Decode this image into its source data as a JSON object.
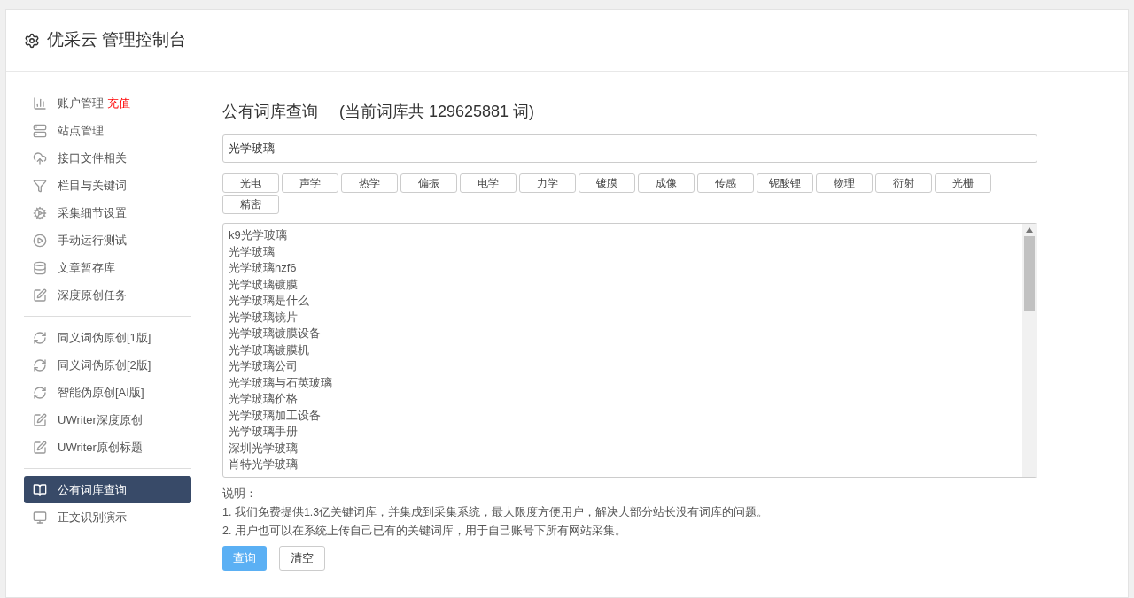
{
  "header": {
    "title": "优采云 管理控制台"
  },
  "sidebar": {
    "groups": [
      {
        "items": [
          {
            "label": "账户管理",
            "badge": "充值",
            "selected": false
          },
          {
            "label": "站点管理",
            "selected": false
          },
          {
            "label": "接口文件相关",
            "selected": false
          },
          {
            "label": "栏目与关键词",
            "selected": false
          },
          {
            "label": "采集细节设置",
            "selected": false
          },
          {
            "label": "手动运行测试",
            "selected": false
          },
          {
            "label": "文章暂存库",
            "selected": false
          },
          {
            "label": "深度原创任务",
            "selected": false
          }
        ]
      },
      {
        "items": [
          {
            "label": "同义词伪原创[1版]",
            "selected": false
          },
          {
            "label": "同义词伪原创[2版]",
            "selected": false
          },
          {
            "label": "智能伪原创[AI版]",
            "selected": false
          },
          {
            "label": "UWriter深度原创",
            "selected": false
          },
          {
            "label": "UWriter原创标题",
            "selected": false
          }
        ]
      },
      {
        "items": [
          {
            "label": "公有词库查询",
            "selected": true
          },
          {
            "label": "正文识别演示",
            "selected": false
          }
        ]
      }
    ]
  },
  "main": {
    "title": "公有词库查询",
    "subtitle": "(当前词库共 129625881 词)",
    "search": {
      "value": "光学玻璃"
    },
    "tags": [
      "光电",
      "声学",
      "热学",
      "偏振",
      "电学",
      "力学",
      "镀膜",
      "成像",
      "传感",
      "铌酸锂",
      "物理",
      "衍射",
      "光栅",
      "精密"
    ],
    "results": [
      "k9光学玻璃",
      "光学玻璃",
      "光学玻璃hzf6",
      "光学玻璃镀膜",
      "光学玻璃是什么",
      "光学玻璃镜片",
      "光学玻璃镀膜设备",
      "光学玻璃镀膜机",
      "光学玻璃公司",
      "光学玻璃与石英玻璃",
      "光学玻璃价格",
      "光学玻璃加工设备",
      "光学玻璃手册",
      "深圳光学玻璃",
      "肖特光学玻璃"
    ],
    "notes": {
      "label": "说明：",
      "lines": [
        "1. 我们免费提供1.3亿关键词库，并集成到采集系统，最大限度方便用户，解决大部分站长没有词库的问题。",
        "2. 用户也可以在系统上传自己已有的关键词库，用于自己账号下所有网站采集。"
      ]
    },
    "buttons": [
      {
        "label": "查询",
        "kind": "primary"
      },
      {
        "label": "清空",
        "kind": "default"
      }
    ]
  }
}
